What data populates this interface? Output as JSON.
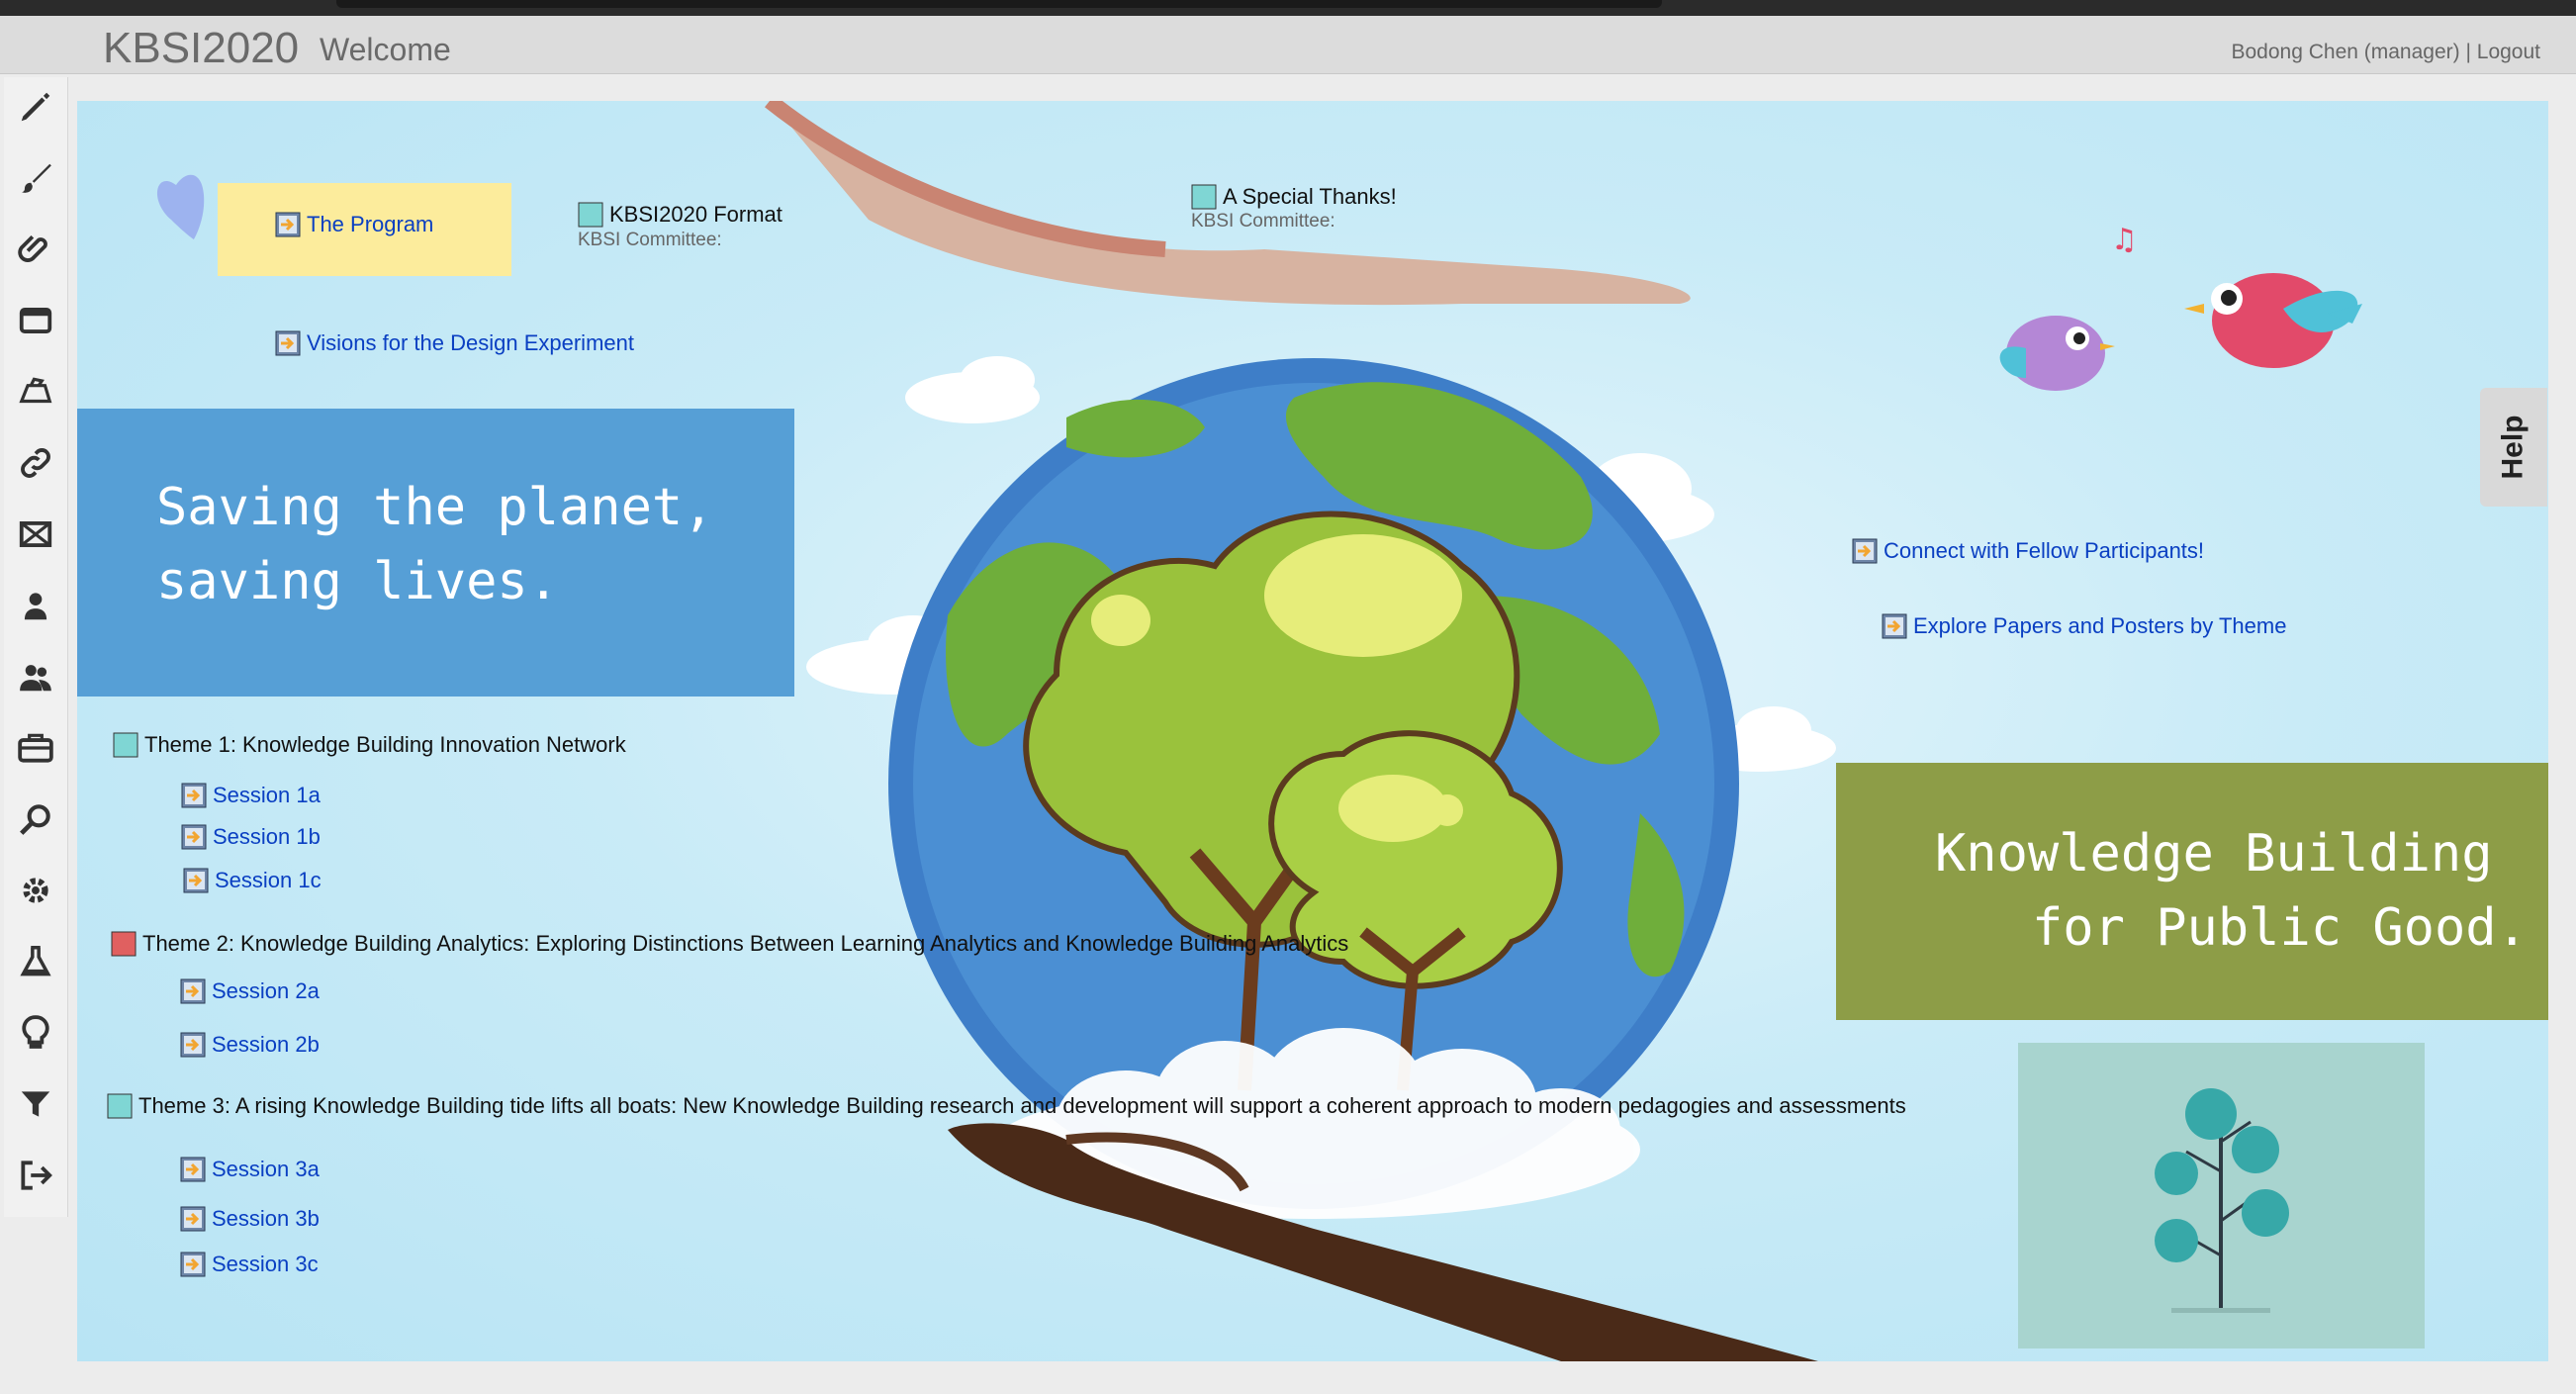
{
  "app": {
    "title": "KBSI2020",
    "view_title": "Welcome"
  },
  "user": {
    "name": "Bodong Chen (manager)",
    "separator": " | ",
    "logout": "Logout"
  },
  "help_label": "Help",
  "toolbar": [
    {
      "name": "pencil-icon"
    },
    {
      "name": "brush-icon"
    },
    {
      "name": "paperclip-icon"
    },
    {
      "name": "window-icon"
    },
    {
      "name": "scriptorium-icon"
    },
    {
      "name": "link-icon"
    },
    {
      "name": "frame-icon"
    },
    {
      "name": "person-icon"
    },
    {
      "name": "people-icon"
    },
    {
      "name": "briefcase-icon"
    },
    {
      "name": "search-icon"
    },
    {
      "name": "gear-icon"
    },
    {
      "name": "flask-icon"
    },
    {
      "name": "lightbulb-icon"
    },
    {
      "name": "filter-icon"
    },
    {
      "name": "exit-icon"
    }
  ],
  "banners": {
    "left_line1": "Saving the planet,",
    "left_line2": "saving lives.",
    "right_line1": "Knowledge Building",
    "right_line2": "for Public Good."
  },
  "notes": {
    "program": "The Program",
    "format": "KBSI2020 Format",
    "format_author": "KBSI Committee:",
    "thanks": "A Special Thanks!",
    "thanks_author": "KBSI Committee:",
    "visions": "Visions for the Design Experiment",
    "connect": "Connect with Fellow Participants!",
    "explore": "Explore Papers and Posters by Theme",
    "theme1": "Theme 1: Knowledge Building Innovation Network",
    "s1a": "Session 1a",
    "s1b": "Session 1b",
    "s1c": "Session 1c",
    "theme2": "Theme 2: Knowledge Building Analytics: Exploring Distinctions Between Learning Analytics and Knowledge Building Analytics",
    "s2a": "Session 2a",
    "s2b": "Session 2b",
    "theme3": "Theme 3: A rising Knowledge Building tide lifts all boats: New Knowledge Building research and development will support a coherent approach to modern pedagogies and assessments",
    "s3a": "Session 3a",
    "s3b": "Session 3b",
    "s3c": "Session 3c"
  },
  "colors": {
    "link": "#0a3fc2",
    "note_teal": "#5fc8c8",
    "note_red": "#e06060",
    "link_icon": "#f2a531"
  }
}
